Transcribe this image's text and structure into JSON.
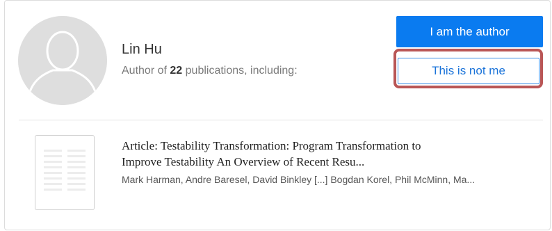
{
  "author": {
    "name": "Lin Hu",
    "publications_prefix": "Author of",
    "publication_count": "22",
    "publications_suffix": "publications, including:"
  },
  "actions": {
    "i_am_author_label": "I am the author",
    "not_me_label": "This is not me"
  },
  "colors": {
    "primary_button": "#0a7bf0",
    "highlight_outline": "#b95656"
  },
  "icons": {
    "avatar": "person-silhouette-icon",
    "thumbnail": "document-thumbnail-icon"
  },
  "publication": {
    "title_line1": "Article: Testability Transformation: Program Transformation to",
    "title_line2": "Improve Testability An Overview of Recent Resu...",
    "authors": "Mark Harman, Andre Baresel, David Binkley [...] Bogdan Korel, Phil McMinn, Ma..."
  }
}
